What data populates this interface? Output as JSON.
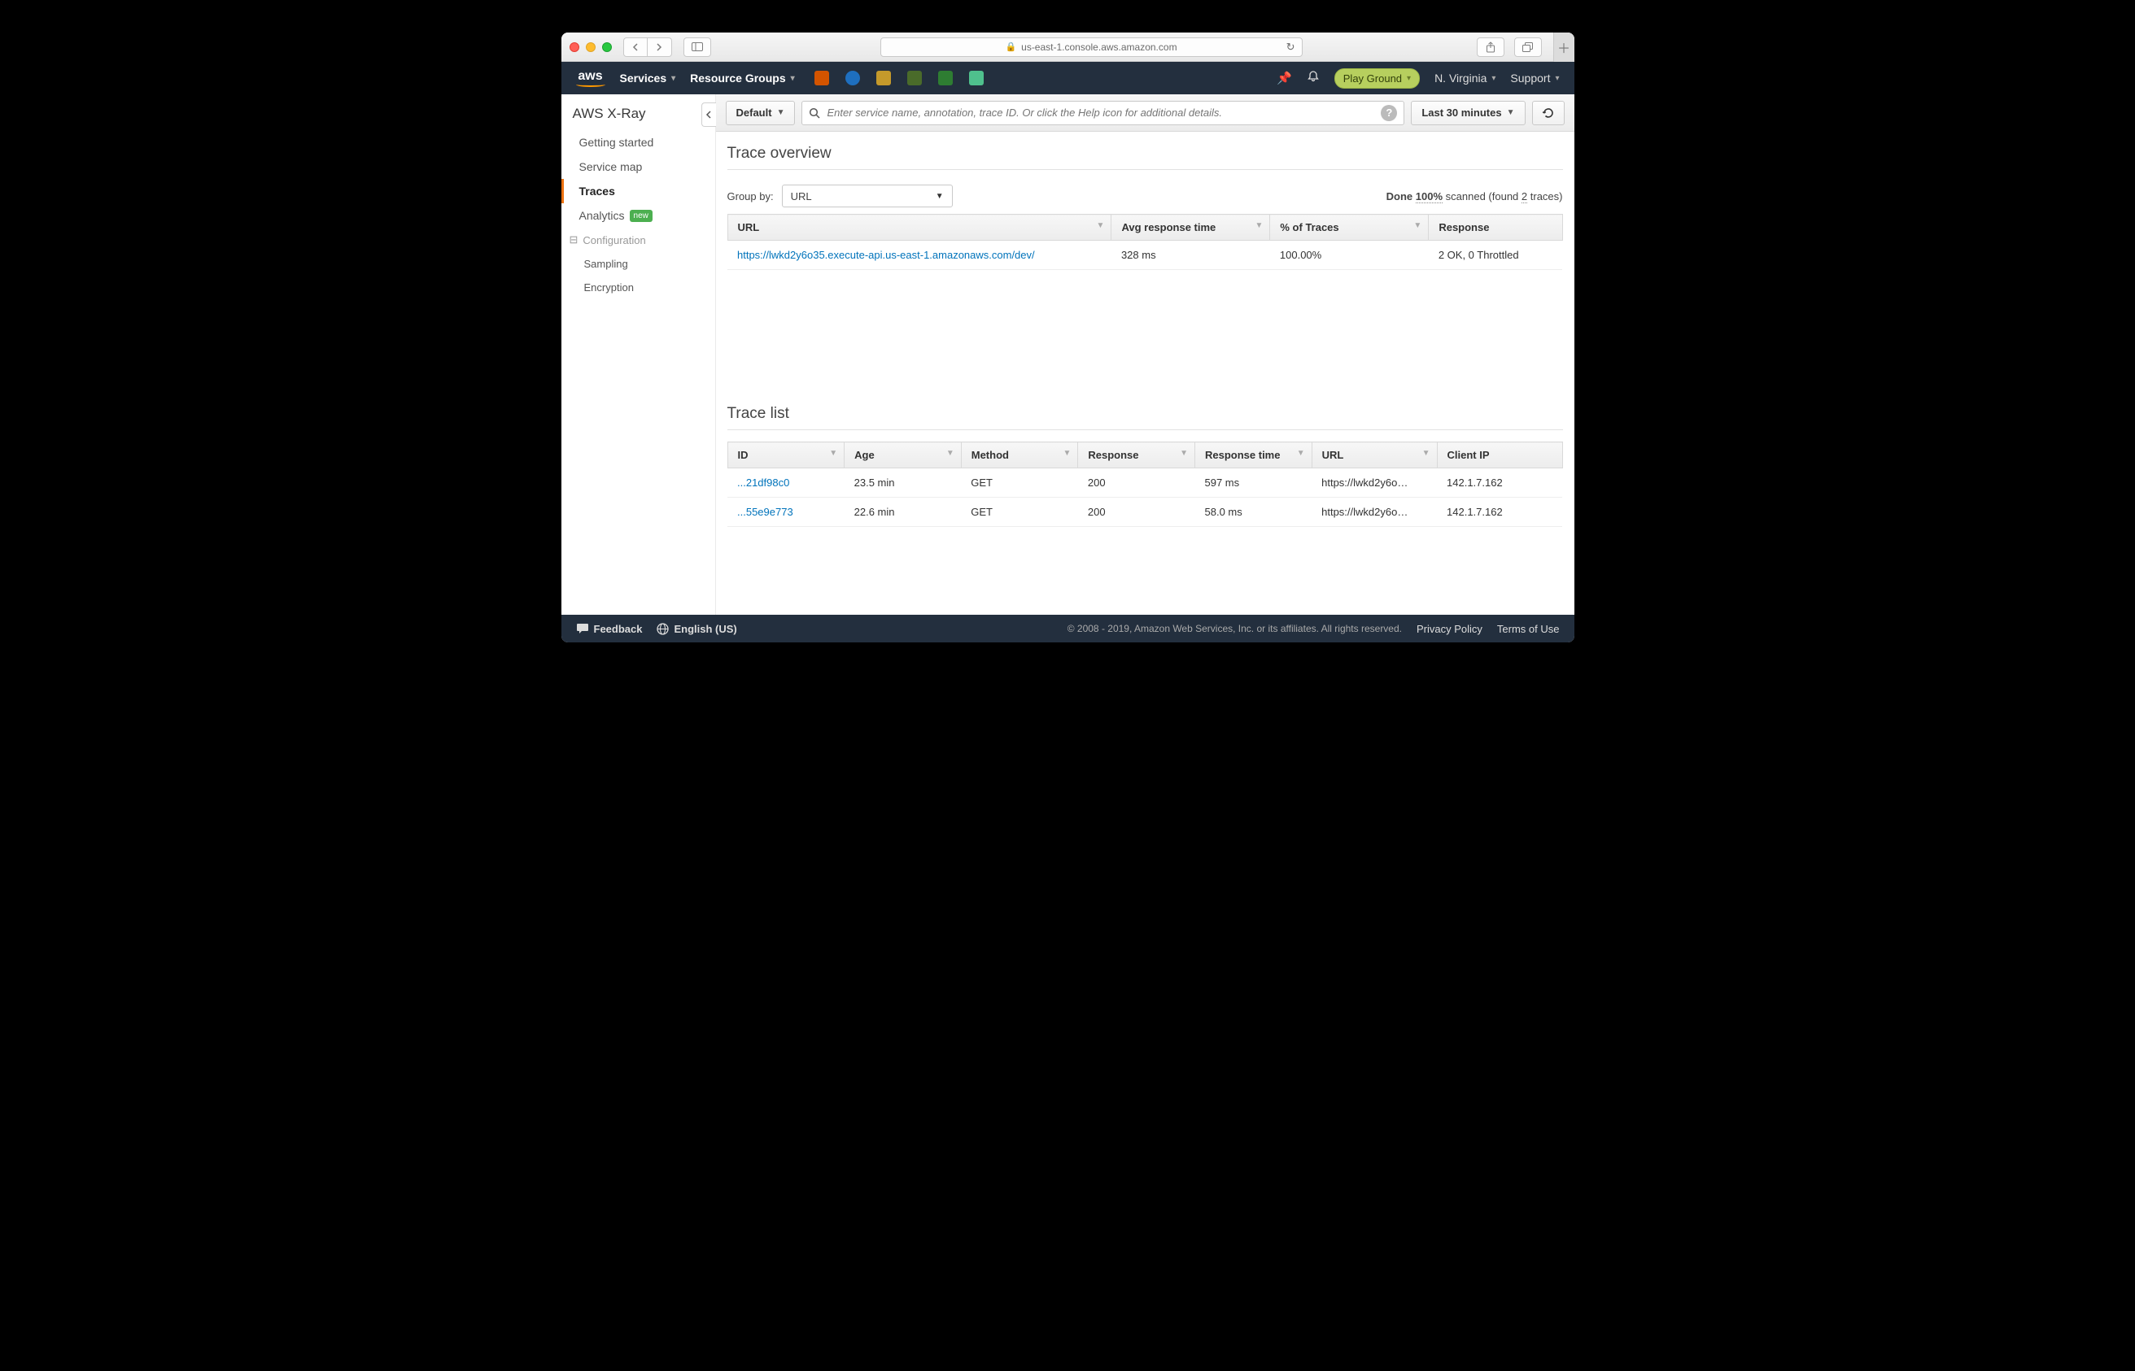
{
  "browser": {
    "url_host": "us-east-1.console.aws.amazon.com"
  },
  "nav": {
    "logo": "aws",
    "services": "Services",
    "resource_groups": "Resource Groups",
    "account_pill": "Play Ground",
    "region": "N. Virginia",
    "support": "Support"
  },
  "sidebar": {
    "title": "AWS X-Ray",
    "items": [
      {
        "label": "Getting started"
      },
      {
        "label": "Service map"
      },
      {
        "label": "Traces"
      },
      {
        "label": "Analytics",
        "badge": "new"
      }
    ],
    "config_group": "Configuration",
    "config_items": [
      {
        "label": "Sampling"
      },
      {
        "label": "Encryption"
      }
    ]
  },
  "toolbar": {
    "default_btn": "Default",
    "search_placeholder": "Enter service name, annotation, trace ID. Or click the Help icon for additional details.",
    "time_range": "Last 30 minutes"
  },
  "overview": {
    "title": "Trace overview",
    "group_by_label": "Group by:",
    "group_by_value": "URL",
    "scan_done": "Done",
    "scan_pct": "100%",
    "scan_scanned": "scanned (found",
    "scan_count": "2",
    "scan_tail": "traces)",
    "columns": {
      "url": "URL",
      "avg": "Avg response time",
      "pct": "% of Traces",
      "resp": "Response"
    },
    "rows": [
      {
        "url": "https://lwkd2y6o35.execute-api.us-east-1.amazonaws.com/dev/",
        "avg": "328 ms",
        "pct": "100.00%",
        "resp": "2 OK, 0 Throttled"
      }
    ]
  },
  "tracelist": {
    "title": "Trace list",
    "columns": {
      "id": "ID",
      "age": "Age",
      "method": "Method",
      "resp": "Response",
      "rt": "Response time",
      "url": "URL",
      "ip": "Client IP"
    },
    "rows": [
      {
        "id": "...21df98c0",
        "age": "23.5 min",
        "method": "GET",
        "resp": "200",
        "rt": "597 ms",
        "url": "https://lwkd2y6o…",
        "ip": "142.1.7.162"
      },
      {
        "id": "...55e9e773",
        "age": "22.6 min",
        "method": "GET",
        "resp": "200",
        "rt": "58.0 ms",
        "url": "https://lwkd2y6o…",
        "ip": "142.1.7.162"
      }
    ]
  },
  "footer": {
    "feedback": "Feedback",
    "language": "English (US)",
    "copyright": "© 2008 - 2019, Amazon Web Services, Inc. or its affiliates. All rights reserved.",
    "privacy": "Privacy Policy",
    "terms": "Terms of Use"
  }
}
